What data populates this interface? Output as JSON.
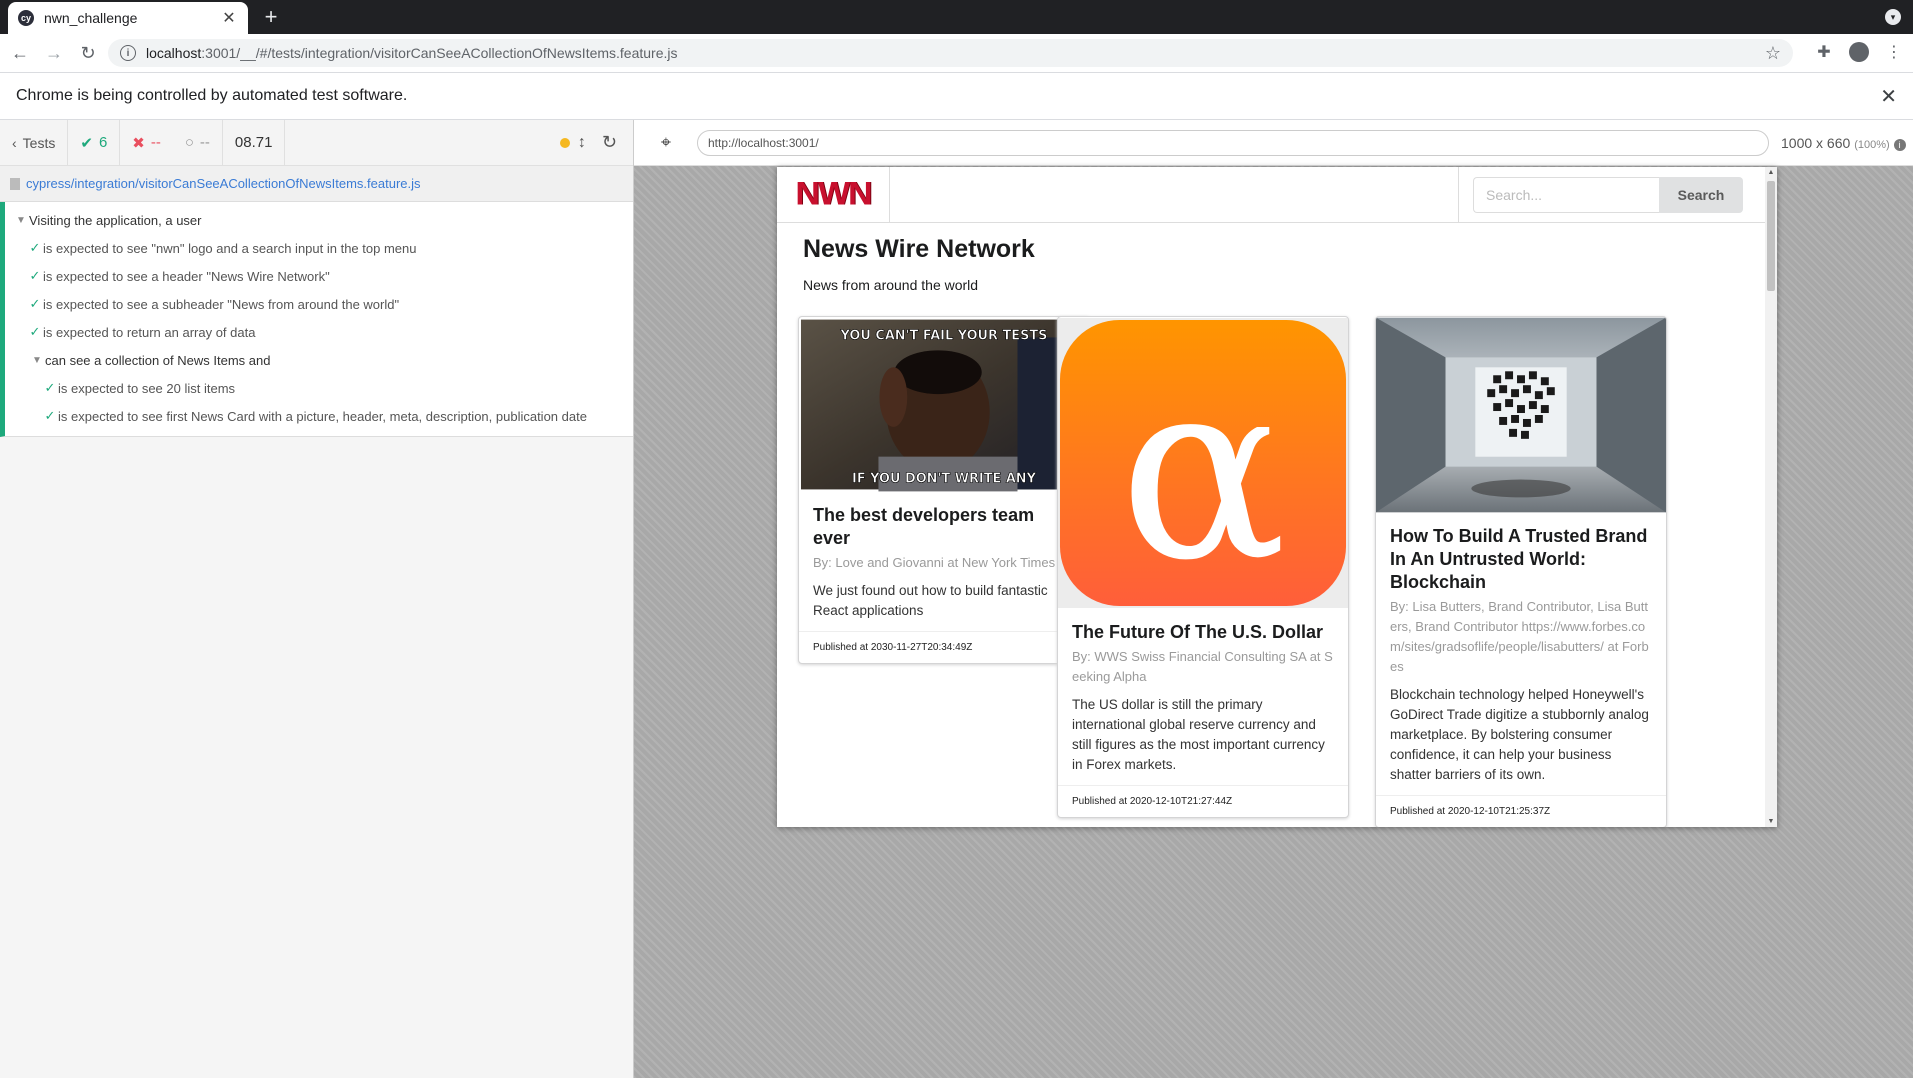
{
  "browser": {
    "tab_title": "nwn_challenge",
    "favicon_text": "cy",
    "url_host": "localhost",
    "url_rest": ":3001/__/#/tests/integration/visitorCanSeeACollectionOfNewsItems.feature.js",
    "infobar_message": "Chrome is being controlled by automated test software."
  },
  "reporter": {
    "tests_label": "Tests",
    "passed": "6",
    "failed": "--",
    "pending": "--",
    "duration": "08.71",
    "spec_path": "cypress/integration/visitorCanSeeACollectionOfNewsItems.feature.js",
    "suite": "Visiting the application, a user",
    "tests": [
      "is expected to see \"nwn\" logo and a search input in the top menu",
      "is expected to see a header \"News Wire Network\"",
      "is expected to see a subheader \"News from around the world\"",
      "is expected to return an array of data"
    ],
    "nested_suite": "can see a collection of News Items and",
    "nested_tests": [
      "is expected to see 20 list items",
      "is expected to see first News Card with a picture, header, meta, description, publication date"
    ]
  },
  "aut": {
    "url": "http://localhost:3001/",
    "size": "1000 x 660",
    "zoom": "(100%)"
  },
  "app": {
    "logo": "NWN",
    "search_placeholder": "Search...",
    "search_button": "Search",
    "title": "News Wire Network",
    "subtitle": "News from around the world",
    "cards": [
      {
        "image_top_text": "YOU CAN'T FAIL YOUR TESTS",
        "image_bottom_text": "IF YOU DON'T WRITE ANY",
        "header": "The best developers team ever",
        "meta": "By: Love and Giovanni at New York Times",
        "description": "We just found out how to build fantastic React applications",
        "published": "Published at 2030-11-27T20:34:49Z"
      },
      {
        "image_glyph": "α",
        "header": "The Future Of The U.S. Dollar",
        "meta": "By: WWS Swiss Financial Consulting SA at Seeking Alpha",
        "description": "The US dollar is still the primary international global reserve currency and still figures as the most important currency in Forex markets.",
        "published": "Published at 2020-12-10T21:27:44Z"
      },
      {
        "header": "How To Build A Trusted Brand In An Untrusted World: Blockchain",
        "meta": "By: Lisa Butters, Brand Contributor, Lisa Butters, Brand Contributor https://www.forbes.com/sites/gradsoflife/people/lisabutters/ at Forbes",
        "description": "Blockchain technology helped Honeywell's GoDirect Trade digitize a stubbornly analog marketplace. By bolstering consumer confidence, it can help your business shatter barriers of its own.",
        "published": "Published at 2020-12-10T21:25:37Z"
      }
    ]
  },
  "colors": {
    "pass": "#1ea97c",
    "fail": "#e94f5f",
    "link": "#3a7bd5",
    "logo": "#c8102e",
    "alpha_gradient_top": "#ff9500",
    "alpha_gradient_bottom": "#ff5e3a"
  }
}
